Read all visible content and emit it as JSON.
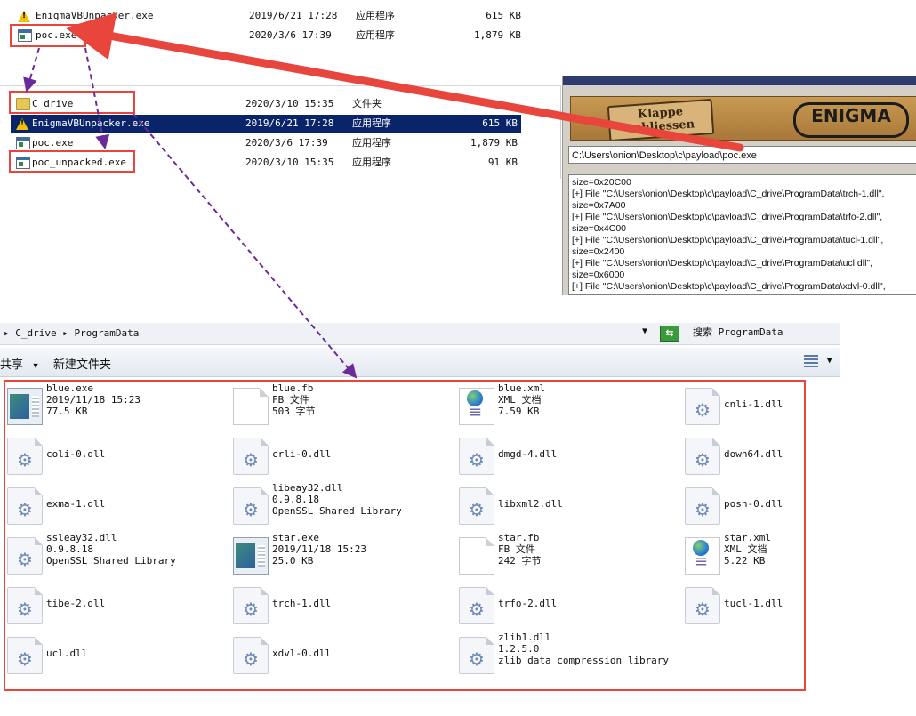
{
  "top_list": [
    {
      "name": "EnigmaVBUnpacker.exe",
      "date": "2019/6/21 17:28",
      "type": "应用程序",
      "size": "615 KB",
      "icon": "warning-icon"
    },
    {
      "name": "poc.exe",
      "date": "2020/3/6 17:39",
      "type": "应用程序",
      "size": "1,879 KB",
      "icon": "exe-icon"
    }
  ],
  "mid_list": [
    {
      "name": "C_drive",
      "date": "2020/3/10 15:35",
      "type": "文件夹",
      "size": "",
      "icon": "folder-icon"
    },
    {
      "name": "EnigmaVBUnpacker.exe",
      "date": "2019/6/21 17:28",
      "type": "应用程序",
      "size": "615 KB",
      "icon": "warning-icon",
      "selected": true
    },
    {
      "name": "poc.exe",
      "date": "2020/3/6 17:39",
      "type": "应用程序",
      "size": "1,879 KB",
      "icon": "exe-icon"
    },
    {
      "name": "poc_unpacked.exe",
      "date": "2020/3/10 15:35",
      "type": "应用程序",
      "size": "91 KB",
      "icon": "exe-icon"
    }
  ],
  "unpacker": {
    "close_label_1": "Klappe",
    "close_label_2": "schliessen",
    "logo": "ENIGMA",
    "path": "C:\\Users\\onion\\Desktop\\c\\payload\\poc.exe",
    "log": [
      "size=0x20C00",
      "[+] File \"C:\\Users\\onion\\Desktop\\c\\payload\\C_drive\\ProgramData\\trch-1.dll\",",
      "size=0x7A00",
      "[+] File \"C:\\Users\\onion\\Desktop\\c\\payload\\C_drive\\ProgramData\\trfo-2.dll\",",
      "size=0x4C00",
      "[+] File \"C:\\Users\\onion\\Desktop\\c\\payload\\C_drive\\ProgramData\\tucl-1.dll\",",
      "size=0x2400",
      "[+] File \"C:\\Users\\onion\\Desktop\\c\\payload\\C_drive\\ProgramData\\ucl.dll\",",
      "size=0x6000",
      "[+] File \"C:\\Users\\onion\\Desktop\\c\\payload\\C_drive\\ProgramData\\xdvl-0.dll\","
    ]
  },
  "explorer": {
    "breadcrumb_1": "C_drive",
    "breadcrumb_2": "ProgramData",
    "search_placeholder": "搜索 ProgramData",
    "share_label": "共享",
    "new_folder_label": "新建文件夹"
  },
  "files": [
    {
      "icon": "exe",
      "lines": [
        "blue.exe",
        "2019/11/18 15:23",
        "77.5 KB"
      ]
    },
    {
      "icon": "doc",
      "lines": [
        "blue.fb",
        "FB 文件",
        "503 字节"
      ]
    },
    {
      "icon": "xml",
      "lines": [
        "blue.xml",
        "XML 文档",
        "7.59 KB"
      ]
    },
    {
      "icon": "dll",
      "lines": [
        "cnli-1.dll"
      ]
    },
    {
      "icon": "dll",
      "lines": [
        "coli-0.dll"
      ]
    },
    {
      "icon": "dll",
      "lines": [
        "crli-0.dll"
      ]
    },
    {
      "icon": "dll",
      "lines": [
        "dmgd-4.dll"
      ]
    },
    {
      "icon": "dll",
      "lines": [
        "down64.dll"
      ]
    },
    {
      "icon": "dll",
      "lines": [
        "exma-1.dll"
      ]
    },
    {
      "icon": "dll",
      "lines": [
        "libeay32.dll",
        "0.9.8.18",
        "OpenSSL Shared Library"
      ]
    },
    {
      "icon": "dll",
      "lines": [
        "libxml2.dll"
      ]
    },
    {
      "icon": "dll",
      "lines": [
        "posh-0.dll"
      ]
    },
    {
      "icon": "dll",
      "lines": [
        "ssleay32.dll",
        "0.9.8.18",
        "OpenSSL Shared Library"
      ]
    },
    {
      "icon": "exe",
      "lines": [
        "star.exe",
        "2019/11/18 15:23",
        "25.0 KB"
      ]
    },
    {
      "icon": "doc",
      "lines": [
        "star.fb",
        "FB 文件",
        "242 字节"
      ]
    },
    {
      "icon": "xml",
      "lines": [
        "star.xml",
        "XML 文档",
        "5.22 KB"
      ]
    },
    {
      "icon": "dll",
      "lines": [
        "tibe-2.dll"
      ]
    },
    {
      "icon": "dll",
      "lines": [
        "trch-1.dll"
      ]
    },
    {
      "icon": "dll",
      "lines": [
        "trfo-2.dll"
      ]
    },
    {
      "icon": "dll",
      "lines": [
        "tucl-1.dll"
      ]
    },
    {
      "icon": "dll",
      "lines": [
        "ucl.dll"
      ]
    },
    {
      "icon": "dll",
      "lines": [
        "xdvl-0.dll"
      ]
    },
    {
      "icon": "dll",
      "lines": [
        "zlib1.dll",
        "1.2.5.0",
        "zlib data compression library"
      ]
    }
  ],
  "colors": {
    "highlight": "#e8463c",
    "arrow_dashed": "#6a2a9a",
    "selection": "#0a246a"
  }
}
